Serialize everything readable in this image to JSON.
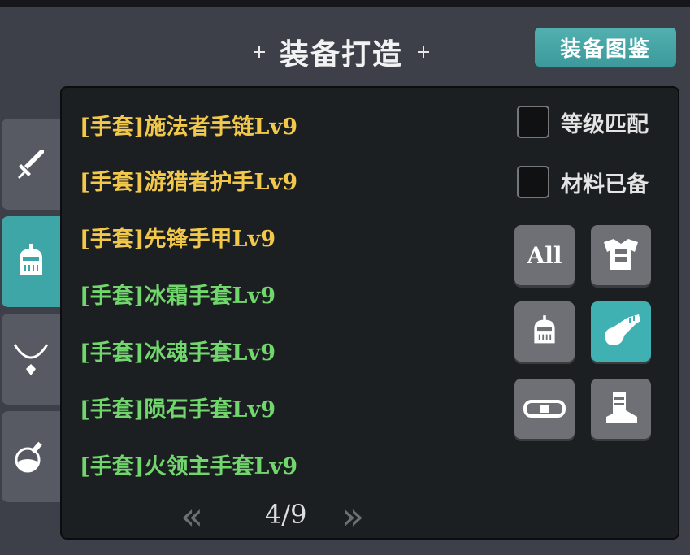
{
  "title": "装备打造",
  "codex_button": "装备图鉴",
  "side_tabs": [
    {
      "icon": "sword-icon",
      "active": false
    },
    {
      "icon": "helmet-icon",
      "active": true
    },
    {
      "icon": "necklace-icon",
      "active": false
    },
    {
      "icon": "potion-icon",
      "active": false
    }
  ],
  "recipes": [
    {
      "label": "[手套]施法者手链Lv9",
      "color": "#f2c84b"
    },
    {
      "label": "[手套]游猎者护手Lv9",
      "color": "#f2c84b"
    },
    {
      "label": "[手套]先锋手甲Lv9",
      "color": "#f2c84b"
    },
    {
      "label": "[手套]冰霜手套Lv9",
      "color": "#71d76d"
    },
    {
      "label": "[手套]冰魂手套Lv9",
      "color": "#71d76d"
    },
    {
      "label": "[手套]陨石手套Lv9",
      "color": "#71d76d"
    },
    {
      "label": "[手套]火领主手套Lv9",
      "color": "#71d76d"
    }
  ],
  "filters": {
    "level_match": "等级匹配",
    "materials_ready": "材料已备"
  },
  "categories": {
    "all": "All",
    "selected": "gloves-icon",
    "icons": [
      "all",
      "armor-icon",
      "helmet-icon",
      "gloves-icon",
      "belt-icon",
      "boots-icon"
    ]
  },
  "pager": {
    "prev": "«",
    "next": "»",
    "page": "4/9"
  },
  "colors": {
    "accent": "#3fa6a8",
    "rare_text": "#f2c84b",
    "uncommon_text": "#71d76d"
  }
}
